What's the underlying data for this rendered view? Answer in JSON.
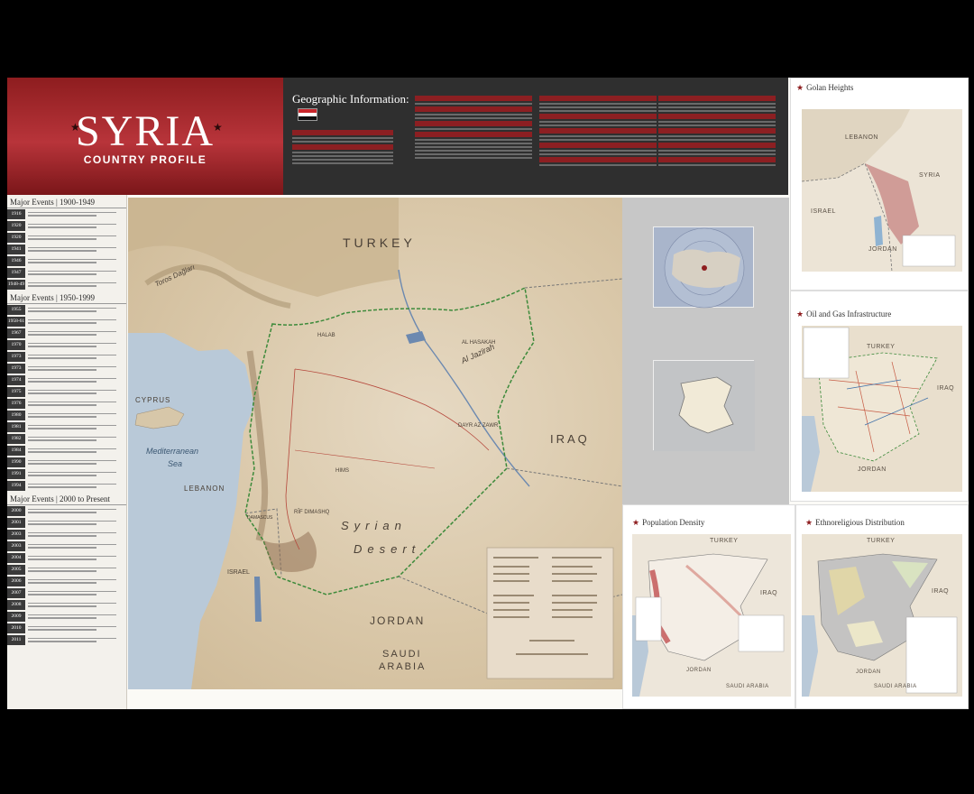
{
  "title": {
    "main": "SYRIA",
    "subtitle": "COUNTRY PROFILE"
  },
  "geo_info": {
    "heading": "Geographic Information:"
  },
  "timeline": {
    "sections": [
      {
        "heading": "Major Events | 1900-1949",
        "years": [
          "1916",
          "1920",
          "1920",
          "1941",
          "1946",
          "1947",
          "1948-49"
        ]
      },
      {
        "heading": "Major Events | 1950-1999",
        "years": [
          "1955",
          "1958-61",
          "1967",
          "1970",
          "1973",
          "1973",
          "1974",
          "1975",
          "1976",
          "1980",
          "1981",
          "1982",
          "1984",
          "1990",
          "1991",
          "1994"
        ]
      },
      {
        "heading": "Major Events | 2000 to Present",
        "years": [
          "2000",
          "2001",
          "2003",
          "2003",
          "2004",
          "2005",
          "2006",
          "2007",
          "2008",
          "2009",
          "2010",
          "2011"
        ]
      }
    ]
  },
  "main_map": {
    "labels": {
      "turkey": "TURKEY",
      "iraq": "IRAQ",
      "jordan": "JORDAN",
      "saudi_1": "SAUDI",
      "saudi_2": "ARABIA",
      "lebanon": "LEBANON",
      "israel": "ISRAEL",
      "cyprus": "CYPRUS",
      "sea_1": "Mediterranean",
      "sea_2": "Sea",
      "desert_1": "Syrian",
      "desert_2": "Desert",
      "taurus": "Toros Dağları",
      "jazirah": "Al Jazīrah",
      "halab": "HALAB",
      "hasakah": "AL HASAKAH",
      "dayr": "DAYR AZ ZAWR",
      "hims": "HIMS",
      "damascus": "DAMASCUS",
      "dimashq": "RĪF DIMASHQ"
    },
    "colors": {
      "land": "#dccbad",
      "water": "#b9c9d8",
      "border": "#3c8a3a",
      "river": "#6c89b0"
    }
  },
  "insets": {
    "golan": {
      "heading": "Golan Heights",
      "labels": {
        "lebanon": "LEBANON",
        "syria": "SYRIA",
        "israel": "ISRAEL",
        "jordan": "JORDAN"
      }
    },
    "oil": {
      "heading": "Oil and Gas Infrastructure",
      "labels": {
        "turkey": "TURKEY",
        "iraq": "IRAQ",
        "jordan": "JORDAN"
      }
    },
    "population": {
      "heading": "Population Density",
      "labels": {
        "turkey": "TURKEY",
        "iraq": "IRAQ",
        "jordan": "JORDAN",
        "saudi": "SAUDI ARABIA"
      }
    },
    "ethno": {
      "heading": "Ethnoreligious Distribution",
      "labels": {
        "turkey": "TURKEY",
        "iraq": "IRAQ",
        "jordan": "JORDAN",
        "saudi": "SAUDI ARABIA"
      }
    }
  }
}
